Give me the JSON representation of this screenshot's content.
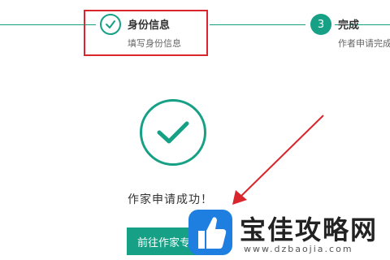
{
  "steps": [
    {
      "title": "身份信息",
      "subtitle": "填写身份信息",
      "state": "done"
    },
    {
      "number": "3",
      "title": "完成",
      "subtitle": "作者申请完成",
      "state": "current"
    }
  ],
  "success_message": "作家申请成功！",
  "go_button_label": "前往作家专区",
  "watermark": {
    "name": "宝佳攻略网",
    "url": "www.dzbaojia.com"
  },
  "colors": {
    "accent": "#16a085",
    "annotation": "#d9262c",
    "watermark_blue": "#1e7fe0"
  },
  "icons": {
    "step_done": "check-circle-icon",
    "success": "check-circle-icon",
    "annotation": "arrow-icon"
  }
}
